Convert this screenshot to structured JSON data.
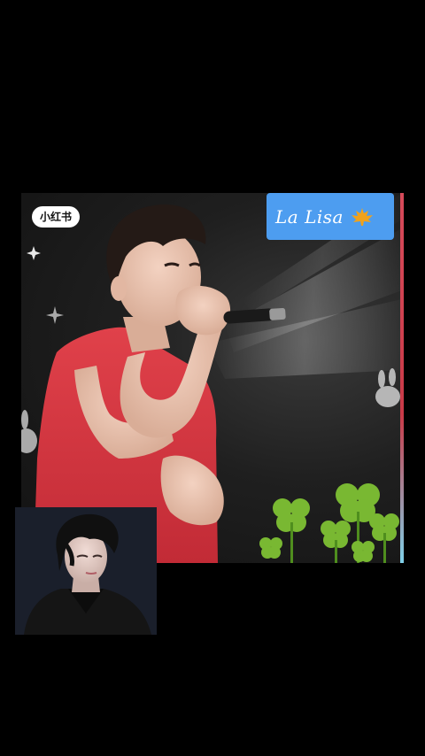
{
  "watermark": {
    "label": "小红书"
  },
  "brand_tag": {
    "label": "La Lisa",
    "icon": "maple-leaf-icon",
    "background": "#4d9df0",
    "icon_color": "#f0a21c"
  },
  "colors": {
    "background": "#000000",
    "shirt": "#d8353f",
    "edge_accent": "#d64a5a",
    "clover": "#79b832"
  }
}
